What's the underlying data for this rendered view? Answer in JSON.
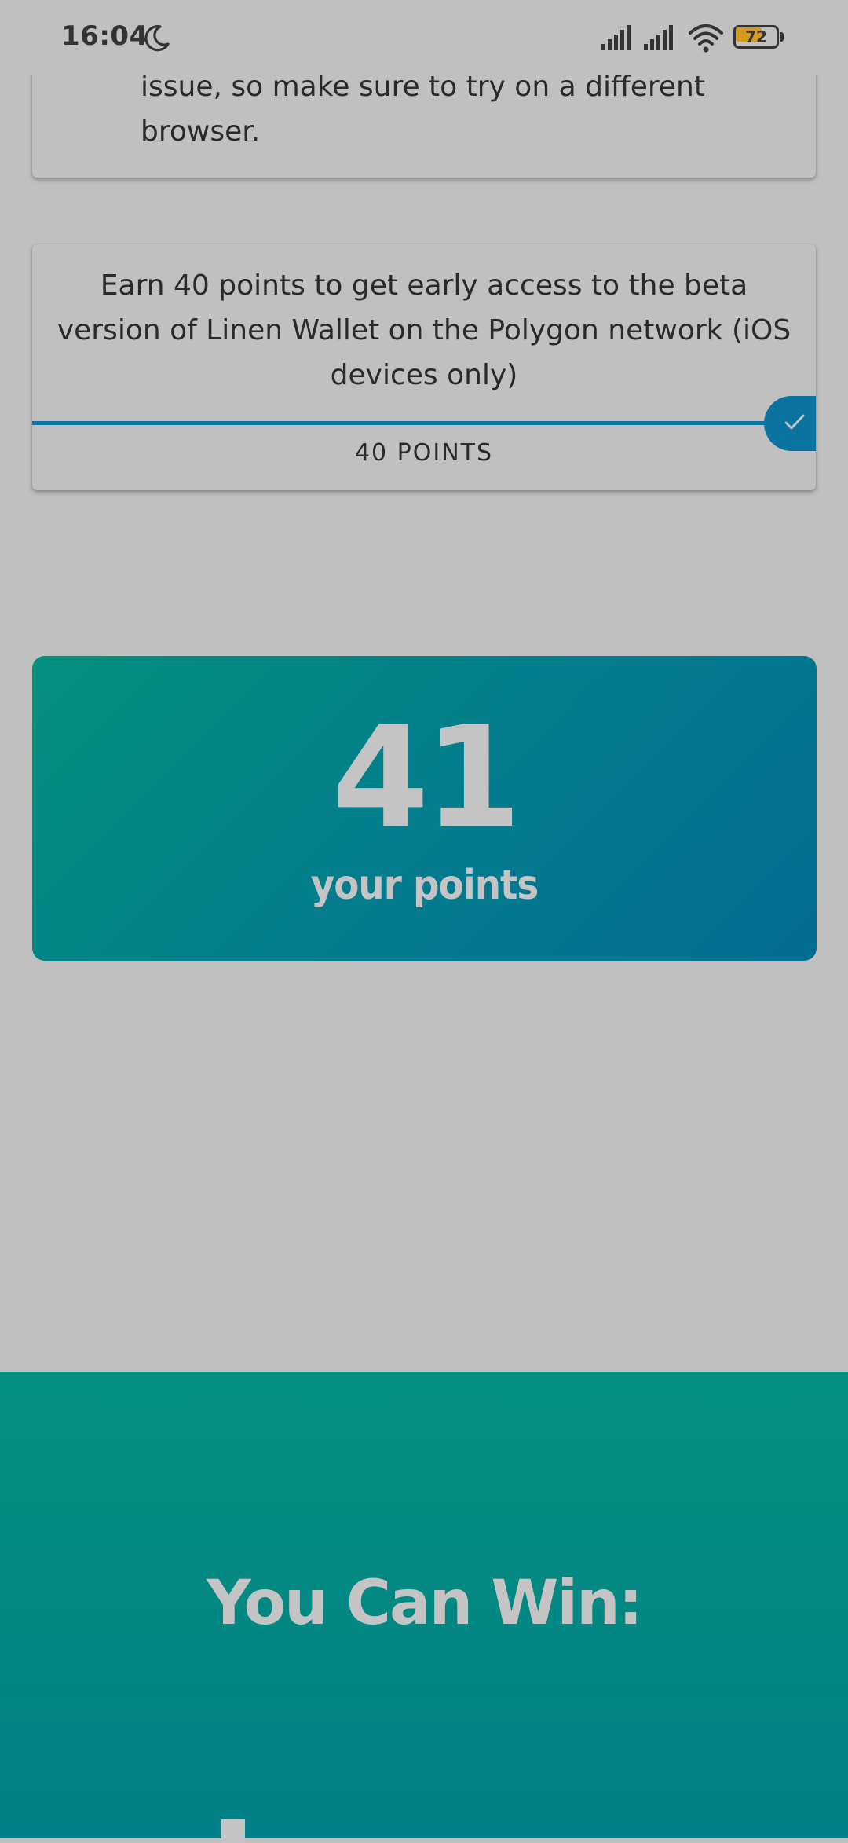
{
  "status_bar": {
    "time": "16:04",
    "battery_level": "72",
    "icons": [
      "moon-icon",
      "signal-icon",
      "signal-icon",
      "wifi-icon",
      "battery-icon"
    ]
  },
  "card_previous": {
    "text": "issue, so make sure to try on a different browser."
  },
  "task_card": {
    "description": "Earn 40 points to get early access to the beta version of Linen Wallet on the Polygon network (iOS devices only)",
    "progress_fraction": 1.0,
    "completed": true,
    "points_label": "40 POINTS"
  },
  "points_summary": {
    "value": "41",
    "caption": "your points"
  },
  "win_section": {
    "title": "You Can Win:"
  },
  "colors": {
    "background": "#c0c0c0",
    "accent_blue": "#0b73a0",
    "teal": "#03907f",
    "light_text": "#c4c4c4"
  }
}
